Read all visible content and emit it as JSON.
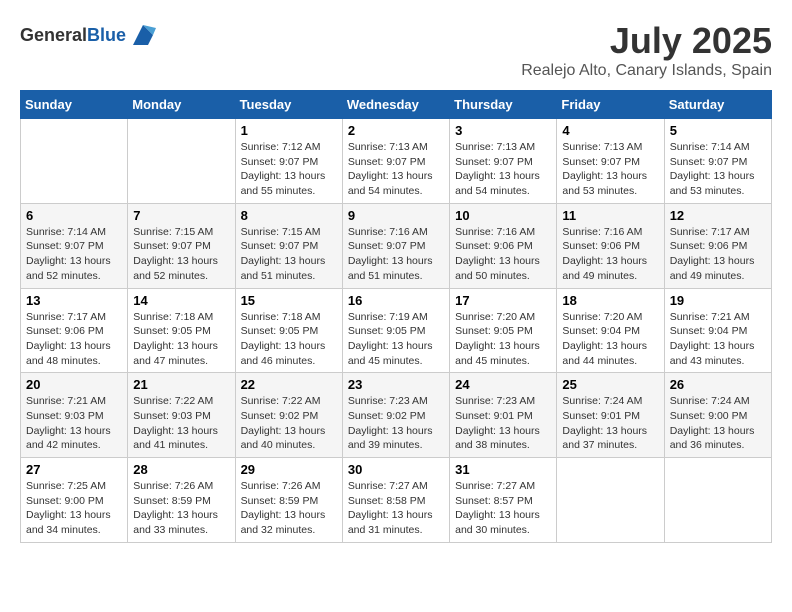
{
  "header": {
    "logo_general": "General",
    "logo_blue": "Blue",
    "month": "July 2025",
    "location": "Realejo Alto, Canary Islands, Spain"
  },
  "weekdays": [
    "Sunday",
    "Monday",
    "Tuesday",
    "Wednesday",
    "Thursday",
    "Friday",
    "Saturday"
  ],
  "weeks": [
    [
      {
        "day": "",
        "sunrise": "",
        "sunset": "",
        "daylight": ""
      },
      {
        "day": "",
        "sunrise": "",
        "sunset": "",
        "daylight": ""
      },
      {
        "day": "1",
        "sunrise": "Sunrise: 7:12 AM",
        "sunset": "Sunset: 9:07 PM",
        "daylight": "Daylight: 13 hours and 55 minutes."
      },
      {
        "day": "2",
        "sunrise": "Sunrise: 7:13 AM",
        "sunset": "Sunset: 9:07 PM",
        "daylight": "Daylight: 13 hours and 54 minutes."
      },
      {
        "day": "3",
        "sunrise": "Sunrise: 7:13 AM",
        "sunset": "Sunset: 9:07 PM",
        "daylight": "Daylight: 13 hours and 54 minutes."
      },
      {
        "day": "4",
        "sunrise": "Sunrise: 7:13 AM",
        "sunset": "Sunset: 9:07 PM",
        "daylight": "Daylight: 13 hours and 53 minutes."
      },
      {
        "day": "5",
        "sunrise": "Sunrise: 7:14 AM",
        "sunset": "Sunset: 9:07 PM",
        "daylight": "Daylight: 13 hours and 53 minutes."
      }
    ],
    [
      {
        "day": "6",
        "sunrise": "Sunrise: 7:14 AM",
        "sunset": "Sunset: 9:07 PM",
        "daylight": "Daylight: 13 hours and 52 minutes."
      },
      {
        "day": "7",
        "sunrise": "Sunrise: 7:15 AM",
        "sunset": "Sunset: 9:07 PM",
        "daylight": "Daylight: 13 hours and 52 minutes."
      },
      {
        "day": "8",
        "sunrise": "Sunrise: 7:15 AM",
        "sunset": "Sunset: 9:07 PM",
        "daylight": "Daylight: 13 hours and 51 minutes."
      },
      {
        "day": "9",
        "sunrise": "Sunrise: 7:16 AM",
        "sunset": "Sunset: 9:07 PM",
        "daylight": "Daylight: 13 hours and 51 minutes."
      },
      {
        "day": "10",
        "sunrise": "Sunrise: 7:16 AM",
        "sunset": "Sunset: 9:06 PM",
        "daylight": "Daylight: 13 hours and 50 minutes."
      },
      {
        "day": "11",
        "sunrise": "Sunrise: 7:16 AM",
        "sunset": "Sunset: 9:06 PM",
        "daylight": "Daylight: 13 hours and 49 minutes."
      },
      {
        "day": "12",
        "sunrise": "Sunrise: 7:17 AM",
        "sunset": "Sunset: 9:06 PM",
        "daylight": "Daylight: 13 hours and 49 minutes."
      }
    ],
    [
      {
        "day": "13",
        "sunrise": "Sunrise: 7:17 AM",
        "sunset": "Sunset: 9:06 PM",
        "daylight": "Daylight: 13 hours and 48 minutes."
      },
      {
        "day": "14",
        "sunrise": "Sunrise: 7:18 AM",
        "sunset": "Sunset: 9:05 PM",
        "daylight": "Daylight: 13 hours and 47 minutes."
      },
      {
        "day": "15",
        "sunrise": "Sunrise: 7:18 AM",
        "sunset": "Sunset: 9:05 PM",
        "daylight": "Daylight: 13 hours and 46 minutes."
      },
      {
        "day": "16",
        "sunrise": "Sunrise: 7:19 AM",
        "sunset": "Sunset: 9:05 PM",
        "daylight": "Daylight: 13 hours and 45 minutes."
      },
      {
        "day": "17",
        "sunrise": "Sunrise: 7:20 AM",
        "sunset": "Sunset: 9:05 PM",
        "daylight": "Daylight: 13 hours and 45 minutes."
      },
      {
        "day": "18",
        "sunrise": "Sunrise: 7:20 AM",
        "sunset": "Sunset: 9:04 PM",
        "daylight": "Daylight: 13 hours and 44 minutes."
      },
      {
        "day": "19",
        "sunrise": "Sunrise: 7:21 AM",
        "sunset": "Sunset: 9:04 PM",
        "daylight": "Daylight: 13 hours and 43 minutes."
      }
    ],
    [
      {
        "day": "20",
        "sunrise": "Sunrise: 7:21 AM",
        "sunset": "Sunset: 9:03 PM",
        "daylight": "Daylight: 13 hours and 42 minutes."
      },
      {
        "day": "21",
        "sunrise": "Sunrise: 7:22 AM",
        "sunset": "Sunset: 9:03 PM",
        "daylight": "Daylight: 13 hours and 41 minutes."
      },
      {
        "day": "22",
        "sunrise": "Sunrise: 7:22 AM",
        "sunset": "Sunset: 9:02 PM",
        "daylight": "Daylight: 13 hours and 40 minutes."
      },
      {
        "day": "23",
        "sunrise": "Sunrise: 7:23 AM",
        "sunset": "Sunset: 9:02 PM",
        "daylight": "Daylight: 13 hours and 39 minutes."
      },
      {
        "day": "24",
        "sunrise": "Sunrise: 7:23 AM",
        "sunset": "Sunset: 9:01 PM",
        "daylight": "Daylight: 13 hours and 38 minutes."
      },
      {
        "day": "25",
        "sunrise": "Sunrise: 7:24 AM",
        "sunset": "Sunset: 9:01 PM",
        "daylight": "Daylight: 13 hours and 37 minutes."
      },
      {
        "day": "26",
        "sunrise": "Sunrise: 7:24 AM",
        "sunset": "Sunset: 9:00 PM",
        "daylight": "Daylight: 13 hours and 36 minutes."
      }
    ],
    [
      {
        "day": "27",
        "sunrise": "Sunrise: 7:25 AM",
        "sunset": "Sunset: 9:00 PM",
        "daylight": "Daylight: 13 hours and 34 minutes."
      },
      {
        "day": "28",
        "sunrise": "Sunrise: 7:26 AM",
        "sunset": "Sunset: 8:59 PM",
        "daylight": "Daylight: 13 hours and 33 minutes."
      },
      {
        "day": "29",
        "sunrise": "Sunrise: 7:26 AM",
        "sunset": "Sunset: 8:59 PM",
        "daylight": "Daylight: 13 hours and 32 minutes."
      },
      {
        "day": "30",
        "sunrise": "Sunrise: 7:27 AM",
        "sunset": "Sunset: 8:58 PM",
        "daylight": "Daylight: 13 hours and 31 minutes."
      },
      {
        "day": "31",
        "sunrise": "Sunrise: 7:27 AM",
        "sunset": "Sunset: 8:57 PM",
        "daylight": "Daylight: 13 hours and 30 minutes."
      },
      {
        "day": "",
        "sunrise": "",
        "sunset": "",
        "daylight": ""
      },
      {
        "day": "",
        "sunrise": "",
        "sunset": "",
        "daylight": ""
      }
    ]
  ]
}
